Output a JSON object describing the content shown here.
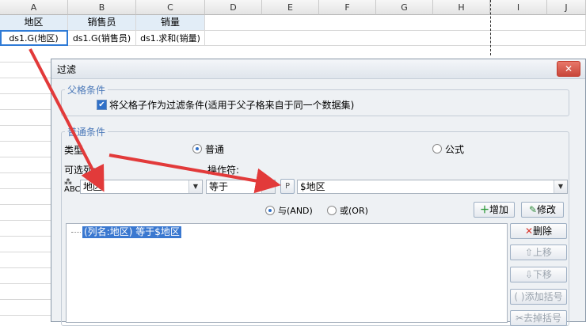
{
  "sheet": {
    "columns": [
      "A",
      "B",
      "C",
      "D",
      "E",
      "F",
      "G",
      "H",
      "I",
      "J"
    ],
    "row1": [
      "地区",
      "销售员",
      "销量"
    ],
    "row2": [
      "ds1.G(地区)",
      "ds1.G(销售员)",
      "ds1.求和(销量)"
    ]
  },
  "dialog": {
    "title": "过滤",
    "close_label": "✕",
    "parent_group": "父格条件",
    "parent_checkbox_label": "将父格子作为过滤条件(适用于父子格来自于同一个数据集)",
    "normal_group": "普通条件",
    "type_label": "类型",
    "type_normal": "普通",
    "type_formula": "公式",
    "column_label": "可选列:",
    "operator_label": "操作符:",
    "column_value": "地区",
    "operator_value": "等于",
    "param_value": "$地区",
    "and_label": "与(AND)",
    "or_label": "或(OR)",
    "add_label": "增加",
    "modify_label": "修改",
    "delete_label": "删除",
    "up_label": "上移",
    "down_label": "下移",
    "add_bracket_label": "添加括号",
    "remove_bracket_label": "去掉括号",
    "condition_item": "(列名:地区) 等于$地区",
    "param_icon": "P"
  },
  "colors": {
    "accent": "#2f70c8",
    "arrow": "#e23a3a",
    "selection": "#2f7bd6"
  }
}
